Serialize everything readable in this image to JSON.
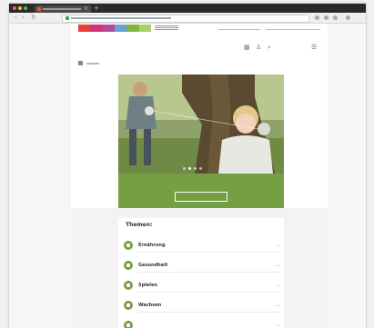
{
  "browser": {
    "icons": {
      "back": "back-arrow-icon",
      "forward": "forward-arrow-icon",
      "reload": "reload-icon",
      "new_tab": "plus-icon",
      "close_tab": "close-icon"
    }
  },
  "site": {
    "brand_colors": [
      "#e8403a",
      "#d2337a",
      "#b44a98",
      "#6aa0d8",
      "#84b544",
      "#a8d06a"
    ],
    "accent": "#74a043",
    "nav": {
      "items": [
        "",
        "",
        ""
      ],
      "icons": [
        "grid-icon",
        "user-icon",
        "search-icon",
        "menu-icon"
      ]
    },
    "breadcrumb": {
      "home_icon": "home-icon",
      "current": ""
    },
    "hero": {
      "slides": 4,
      "active_slide": 2,
      "caption": "",
      "button": ""
    },
    "themen": {
      "title": "Themen:",
      "items": [
        {
          "label": "Ernährung",
          "icon": "food-icon"
        },
        {
          "label": "Gesundheit",
          "icon": "health-icon"
        },
        {
          "label": "Spielen",
          "icon": "play-icon"
        },
        {
          "label": "Wachsen",
          "icon": "growth-icon"
        },
        {
          "label": "",
          "icon": "family-icon"
        }
      ]
    }
  }
}
